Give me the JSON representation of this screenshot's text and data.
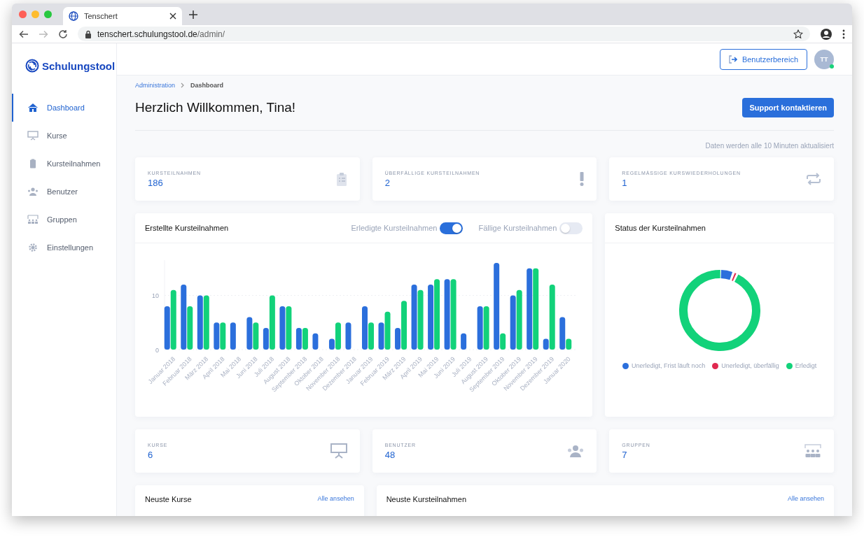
{
  "browser": {
    "tab_title": "Tenschert",
    "url_host": "tenschert.schulungstool.de",
    "url_path": "/admin/"
  },
  "sidebar": {
    "logo": "Schulungstool",
    "items": [
      {
        "label": "Dashboard",
        "selected": true
      },
      {
        "label": "Kurse",
        "selected": false
      },
      {
        "label": "Kursteilnahmen",
        "selected": false
      },
      {
        "label": "Benutzer",
        "selected": false
      },
      {
        "label": "Gruppen",
        "selected": false
      },
      {
        "label": "Einstellungen",
        "selected": false
      }
    ]
  },
  "topbar": {
    "button": "Benutzerbereich",
    "avatar": "TT"
  },
  "breadcrumb": [
    "Administration",
    "Dashboard"
  ],
  "title": "Herzlich Willkommen, Tina!",
  "support_button": "Support kontaktieren",
  "update_note": "Daten werden alle 10 Minuten aktualisiert",
  "stats": [
    {
      "label": "KURSTEILNAHMEN",
      "value": "186"
    },
    {
      "label": "ÜBERFÄLLIGE KURSTEILNAHMEN",
      "value": "2"
    },
    {
      "label": "REGELMÄSSIGE KURSWIEDERHOLUNGEN",
      "value": "1"
    }
  ],
  "chart_card": {
    "title": "Erstellte Kursteilnahmen",
    "toggles": [
      {
        "label": "Erledigte Kursteilnahmen",
        "on": true
      },
      {
        "label": "Fällige Kursteilnahmen",
        "on": false
      }
    ],
    "chart_data": {
      "type": "bar",
      "categories": [
        "Januar 2018",
        "Februar 2018",
        "März 2018",
        "April 2018",
        "Mai 2018",
        "Juni 2018",
        "Juli 2018",
        "August 2018",
        "September 2018",
        "Oktober 2018",
        "November 2018",
        "Dezember 2018",
        "Januar 2019",
        "Februar 2019",
        "März 2019",
        "April 2019",
        "Mai 2019",
        "Juni 2019",
        "Juli 2019",
        "August 2019",
        "September 2019",
        "Oktober 2019",
        "November 2019",
        "Dezember 2019",
        "Januar 2020"
      ],
      "series": [
        {
          "color": "#2b6fdc",
          "values": [
            8,
            12,
            10,
            5,
            5,
            6,
            4,
            8,
            4,
            3,
            2,
            5,
            8,
            5,
            4,
            12,
            12,
            13,
            3,
            8,
            16,
            10,
            15,
            2,
            6
          ]
        },
        {
          "color": "#12d27a",
          "values": [
            11,
            8,
            10,
            5,
            null,
            5,
            10,
            8,
            4,
            null,
            5,
            null,
            5,
            7,
            9,
            11,
            13,
            13,
            null,
            8,
            3,
            11,
            15,
            12,
            2
          ]
        }
      ],
      "ylim": [
        0,
        16.5
      ],
      "yticks": [
        0,
        10
      ]
    }
  },
  "status_card": {
    "title": "Status der Kursteilnahmen",
    "legend": [
      {
        "label": "Unerledigt, Frist läuft noch",
        "color": "#2b6fdc"
      },
      {
        "label": "Unerledigt, überfällig",
        "color": "#e0284f"
      },
      {
        "label": "Erledigt",
        "color": "#12d27a"
      }
    ]
  },
  "stats2": [
    {
      "label": "KURSE",
      "value": "6"
    },
    {
      "label": "BENUTZER",
      "value": "48"
    },
    {
      "label": "GRUPPEN",
      "value": "7"
    }
  ],
  "lists": [
    {
      "title": "Neuste Kurse",
      "link": "Alle ansehen"
    },
    {
      "title": "Neuste Kursteilnahmen",
      "link": "Alle ansehen"
    }
  ]
}
